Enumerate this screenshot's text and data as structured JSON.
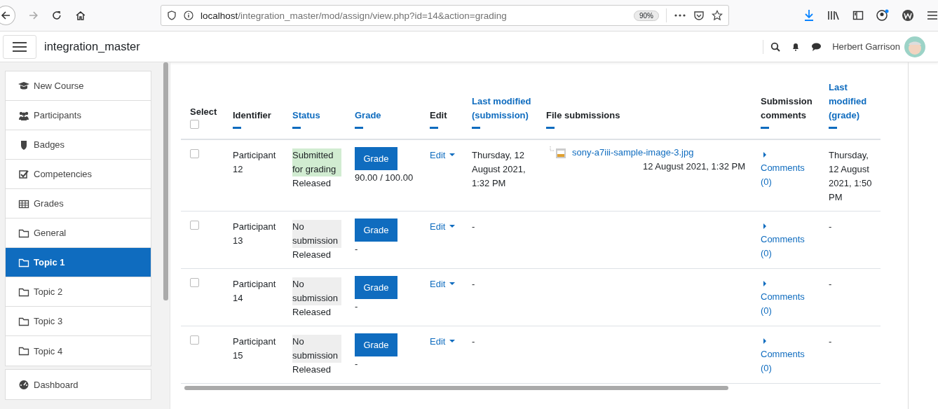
{
  "browser": {
    "url_host": "localhost",
    "url_path": "/integration_master/mod/assign/view.php?id=14&action=grading",
    "zoom": "90%"
  },
  "navbar": {
    "site": "integration_master",
    "user": "Herbert Garrison"
  },
  "sidebar": {
    "items": [
      {
        "label": "New Course",
        "kind": "course",
        "selected": false
      },
      {
        "label": "Participants",
        "kind": "users",
        "selected": false
      },
      {
        "label": "Badges",
        "kind": "shield",
        "selected": false
      },
      {
        "label": "Competencies",
        "kind": "check",
        "selected": false
      },
      {
        "label": "Grades",
        "kind": "table",
        "selected": false
      },
      {
        "label": "General",
        "kind": "folder",
        "selected": false
      },
      {
        "label": "Topic 1",
        "kind": "folder",
        "selected": true
      },
      {
        "label": "Topic 2",
        "kind": "folder",
        "selected": false
      },
      {
        "label": "Topic 3",
        "kind": "folder",
        "selected": false
      },
      {
        "label": "Topic 4",
        "kind": "folder",
        "selected": false
      }
    ],
    "items2": [
      {
        "label": "Dashboard",
        "kind": "gauge",
        "selected": false
      }
    ]
  },
  "table": {
    "select_all": {
      "checked": false
    },
    "columns": [
      {
        "label": "Select",
        "sortable": false
      },
      {
        "label": "Identifier",
        "sortable": false
      },
      {
        "label": "Status",
        "sortable": true
      },
      {
        "label": "Grade",
        "sortable": true
      },
      {
        "label": "Edit",
        "sortable": false
      },
      {
        "label": "Last modified (submission)",
        "sortable": true
      },
      {
        "label": "File submissions",
        "sortable": false
      },
      {
        "label": "Submission comments",
        "sortable": false
      },
      {
        "label": "Last modified (grade)",
        "sortable": true
      }
    ],
    "rows": [
      {
        "checked": false,
        "identifier": "Participant 12",
        "status": {
          "text": "Submitted for grading",
          "color": "#d1ecd1"
        },
        "release": "Released",
        "grade_button": "Grade",
        "grade": "90.00 / 100.00",
        "edit": "Edit",
        "last_modified": "Thursday, 12 August 2021, 1:32 PM",
        "file": {
          "name": "sony-a7iii-sample-image-3.jpg",
          "date": "12 August 2021, 1:32 PM"
        },
        "comments": "Comments (0)",
        "last_modified_grade": "Thursday, 12 August 2021, 1:50 PM"
      },
      {
        "checked": false,
        "identifier": "Participant 13",
        "status": {
          "text": "No submission",
          "color": "#eeeeee"
        },
        "release": "Released",
        "grade_button": "Grade",
        "grade": "-",
        "edit": "Edit",
        "last_modified": "-",
        "comments": "Comments (0)",
        "last_modified_grade": "-"
      },
      {
        "checked": false,
        "identifier": "Participant 14",
        "status": {
          "text": "No submission",
          "color": "#eeeeee"
        },
        "release": "Released",
        "grade_button": "Grade",
        "grade": "-",
        "edit": "Edit",
        "last_modified": "-",
        "comments": "Comments (0)",
        "last_modified_grade": "-"
      },
      {
        "checked": false,
        "identifier": "Participant 15",
        "status": {
          "text": "No submission",
          "color": "#eeeeee"
        },
        "release": "Released",
        "grade_button": "Grade",
        "grade": "-",
        "edit": "Edit",
        "last_modified": "-",
        "comments": "Comments (0)",
        "last_modified_grade": "-"
      }
    ]
  }
}
